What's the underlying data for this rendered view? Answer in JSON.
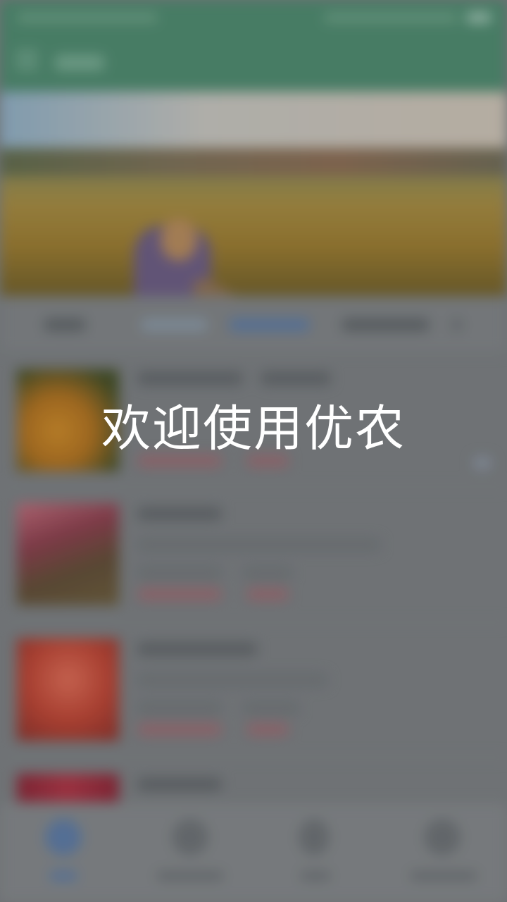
{
  "splash": {
    "welcome_text": "欢迎使用优农"
  },
  "background": {
    "description_colors": {
      "app_bar": "#4a8a6c",
      "overlay_text": "#ffffff",
      "accent_tab": "#5a7aa6"
    },
    "bottom_nav": {
      "icons": [
        "home-icon",
        "chat-icon",
        "pen-icon",
        "profile-icon"
      ]
    }
  }
}
